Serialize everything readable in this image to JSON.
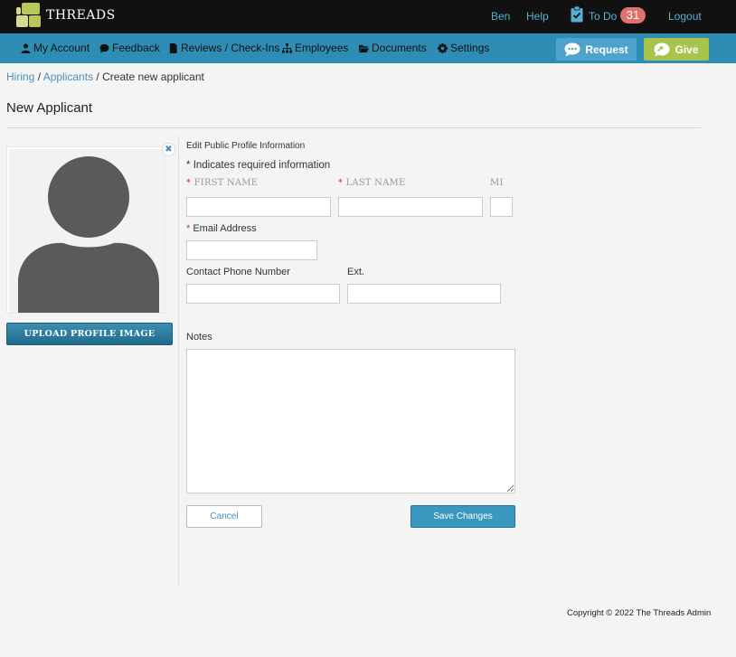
{
  "app": {
    "brand": "THREADS"
  },
  "topbar": {
    "user": "Ben",
    "help": "Help",
    "todo_label": "To Do",
    "todo_count": "31",
    "logout": "Logout"
  },
  "nav": {
    "items": [
      {
        "label": "My Account",
        "icon": "user-icon"
      },
      {
        "label": "Feedback",
        "icon": "chat-bubble-icon"
      },
      {
        "label": "Reviews / Check-Ins",
        "icon": "document-icon"
      },
      {
        "label": "Employees",
        "icon": "org-chart-icon"
      },
      {
        "label": "Documents",
        "icon": "folder-open-icon"
      },
      {
        "label": "Settings",
        "icon": "gear-icon"
      }
    ],
    "request_label": "Request",
    "give_label": "Give"
  },
  "breadcrumb": {
    "hiring": "Hiring",
    "applicants": "Applicants",
    "current": "Create new applicant",
    "separator": "/"
  },
  "page": {
    "title": "New Applicant"
  },
  "profile": {
    "upload_label": "UPLOAD PROFILE IMAGE"
  },
  "form": {
    "section_title": "Edit Public Profile Information",
    "required_note": "Indicates required information",
    "required_mark": "*",
    "first_name_label": "FIRST NAME",
    "last_name_label": "LAST NAME",
    "mi_label": "MI",
    "email_label": "Email Address",
    "phone_label": "Contact Phone Number",
    "ext_label": "Ext.",
    "notes_label": "Notes",
    "first_name_value": "",
    "last_name_value": "",
    "mi_value": "",
    "email_value": "",
    "phone_value": "",
    "ext_value": "",
    "notes_value": "",
    "cancel_label": "Cancel",
    "save_label": "Save Changes"
  },
  "footer": {
    "copyright": "Copyright © 2022 The Threads Admin"
  },
  "colors": {
    "topbar_bg": "#111111",
    "navbar_bg": "#2e8db5",
    "request_bg": "#4ea3cc",
    "give_bg": "#a9c44c",
    "badge_bg": "#e0706c",
    "link": "#4a90c2",
    "avatar": "#5a5a5c"
  }
}
